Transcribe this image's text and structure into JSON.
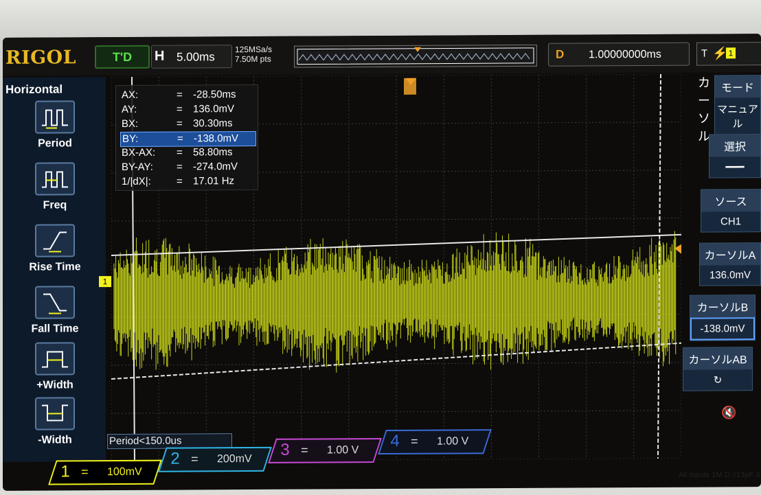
{
  "topbar": {
    "brand": "RIGOL",
    "trigger_status": "T'D",
    "horizontal_label": "H",
    "timebase": "5.00ms",
    "sample_rate": "125MSa/s",
    "memory_depth": "7.50M pts",
    "trigger_delay_label": "D",
    "trigger_delay": "1.00000000ms",
    "trigger_source_text": "T",
    "trigger_channel": "1"
  },
  "left_panel": {
    "title": "Horizontal",
    "items": [
      {
        "label": "Period",
        "icon": "period-icon"
      },
      {
        "label": "Freq",
        "icon": "freq-icon"
      },
      {
        "label": "Rise Time",
        "icon": "rise-time-icon"
      },
      {
        "label": "Fall Time",
        "icon": "fall-time-icon"
      },
      {
        "label": "+Width",
        "icon": "plus-width-icon"
      },
      {
        "label": "-Width",
        "icon": "minus-width-icon"
      }
    ]
  },
  "cursor_readout": {
    "rows": [
      {
        "key": "AX:",
        "eq": "=",
        "value": "-28.50ms"
      },
      {
        "key": "AY:",
        "eq": "=",
        "value": "136.0mV"
      },
      {
        "key": "BX:",
        "eq": "=",
        "value": "30.30ms"
      },
      {
        "key": "BY:",
        "eq": "=",
        "value": "-138.0mV"
      },
      {
        "key": "BX-AX:",
        "eq": "=",
        "value": "58.80ms"
      },
      {
        "key": "BY-AY:",
        "eq": "=",
        "value": "-274.0mV"
      },
      {
        "key": "1/|dX|:",
        "eq": "=",
        "value": "17.01 Hz"
      }
    ],
    "selected_row": 3
  },
  "right_menu": {
    "vertical_title": "カーソル",
    "mode_header": "モード",
    "mode_value": "マニュアル",
    "select_header": "選択",
    "source_header": "ソース",
    "source_value": "CH1",
    "cursor_a_header": "カーソルA",
    "cursor_a_value": "136.0mV",
    "cursor_b_header": "カーソルB",
    "cursor_b_value": "-138.0mV",
    "cursor_ab_header": "カーソルAB"
  },
  "bottom": {
    "period_readout": "Period<150.0us",
    "channels": [
      {
        "num": "1",
        "eq": "=",
        "scale": "100mV",
        "color": "#f2f21e"
      },
      {
        "num": "2",
        "eq": "=",
        "scale": "200mV",
        "color": "#2fb6e6"
      },
      {
        "num": "3",
        "eq": "=",
        "scale": "1.00 V",
        "color": "#c84ad6"
      },
      {
        "num": "4",
        "eq": "=",
        "scale": "1.00 V",
        "color": "#3a6bd8"
      }
    ],
    "inputs_note": "All Inputs 1M Ω //13pF 3"
  },
  "colors": {
    "ch1_trace": "#d8e61a",
    "grid": "#3c3c3c",
    "accent_orange": "#f0a028",
    "brand_gold": "#e8b823",
    "menu_blue": "#18283c"
  }
}
